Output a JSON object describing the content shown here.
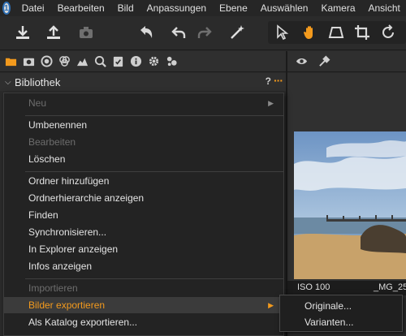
{
  "menubar": {
    "items": [
      "Datei",
      "Bearbeiten",
      "Bild",
      "Anpassungen",
      "Ebene",
      "Auswählen",
      "Kamera",
      "Ansicht"
    ]
  },
  "toolbar": {
    "icons": [
      "import-icon",
      "export-icon",
      "camera-icon",
      "undo-all-icon",
      "undo-icon",
      "redo-icon",
      "magic-wand-icon",
      "select-icon",
      "hand-pan-icon",
      "keystone-icon",
      "crop-icon",
      "rotate-icon"
    ]
  },
  "tools_tabs": [
    "library-tab",
    "capture-tab",
    "color-tab",
    "adjust-tab",
    "exposure-tab",
    "details-tab",
    "metadata-tab",
    "info-tab",
    "settings-tab",
    "batch-tab"
  ],
  "section": {
    "title": "Bibliothek",
    "help": "?",
    "more": "···"
  },
  "context_menu": {
    "items": [
      {
        "label": "Neu",
        "disabled": true,
        "submenu": true
      },
      {
        "label": "Umbenennen",
        "disabled": false
      },
      {
        "label": "Bearbeiten",
        "disabled": true
      },
      {
        "label": "Löschen",
        "disabled": false
      },
      {
        "label": "Ordner hinzufügen",
        "disabled": false
      },
      {
        "label": "Ordnerhierarchie anzeigen",
        "disabled": false
      },
      {
        "label": "Finden",
        "disabled": false
      },
      {
        "label": "Synchronisieren...",
        "disabled": false
      },
      {
        "label": "In Explorer anzeigen",
        "disabled": false
      },
      {
        "label": "Infos anzeigen",
        "disabled": false
      },
      {
        "label": "Importieren",
        "disabled": true
      },
      {
        "label": "Bilder exportieren",
        "disabled": false,
        "highlighted": true,
        "submenu": true
      },
      {
        "label": "Als Katalog exportieren...",
        "disabled": false
      }
    ]
  },
  "submenu": {
    "items": [
      "Originale...",
      "Varianten..."
    ]
  },
  "viewer": {
    "iso": "ISO 100",
    "filename": "_MG_25"
  },
  "colors": {
    "accent": "#f39a1d",
    "background": "#2b2b2b",
    "menu_bg": "#232323"
  }
}
